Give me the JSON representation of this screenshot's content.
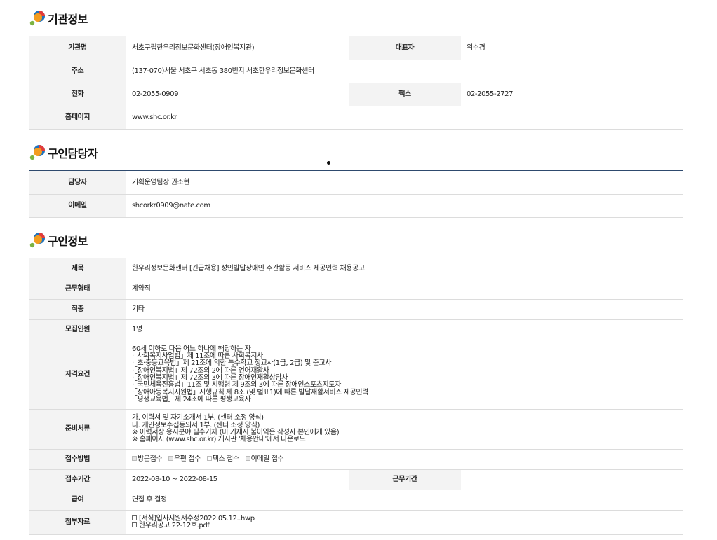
{
  "org": {
    "title": "기관정보",
    "rows": {
      "name_label": "기관명",
      "name_value": "서초구립한우리정보문화센터(장애인복지관)",
      "rep_label": "대표자",
      "rep_value": "위수경",
      "addr_label": "주소",
      "addr_value": "(137-070)서울 서초구 서초동 380번지 서초한우리정보문화센터",
      "tel_label": "전화",
      "tel_value": "02-2055-0909",
      "fax_label": "팩스",
      "fax_value": "02-2055-2727",
      "home_label": "홈페이지",
      "home_value": "www.shc.or.kr"
    }
  },
  "contact": {
    "title": "구인담당자",
    "rows": {
      "person_label": "담당자",
      "person_value": "기획운영팀장 권소현",
      "email_label": "이메일",
      "email_value": "shcorkr0909@nate.com"
    }
  },
  "job": {
    "title": "구인정보",
    "rows": {
      "subject_label": "제목",
      "subject_value": "한우리정보문화센터 [긴급채용] 성인발달장애인 주간활동 서비스 제공인력 채용공고",
      "type_label": "근무형태",
      "type_value": "계약직",
      "kind_label": "직종",
      "kind_value": "기타",
      "count_label": "모집인원",
      "count_value": "1명",
      "qual_label": "자격요건",
      "qual_lines": [
        "60세 이하로 다음 어느 하나에 해당하는 자",
        "·「사회복지사업법」제 11조에 따른 사회복지사",
        "·「초·중등교육법」제 21조에 의한 특수학교 정교사(1급, 2급) 및 준교사",
        "·「장애인복지법」제 72조의 2에 따른 언어재활사",
        "·「장애인복지법」제 72조의 3에 따른 장애인재활상담사",
        "·「국민체육진흥법」11조 및 시행령 제 9조의 3에 따른 장애인스포츠지도자",
        "·「장애아동복지지원법」시행규칙 제 8조 (및 별표1)에 따른 발달재활서비스 제공인력",
        "·「평생교육법」제 24조에 따른 평생교육사"
      ],
      "docs_label": "준비서류",
      "docs_lines": [
        "가. 이력서 및 자기소개서 1부. (센터 소정 양식)",
        "나. 개인정보수집동의서 1부. (센터 소정 양식)",
        "※ 이력서상 응시분야 필수기재 (미 기재시 불이익은 작성자 본인에게 있음)",
        "※ 홈페이지 (www.shc.or.kr) 게시판 '채용안내'에서 다운로드"
      ],
      "method_label": "접수방법",
      "method_options": [
        "방문접수",
        "우편 접수",
        "팩스 접수",
        "이메일 접수"
      ],
      "period_label": "접수기간",
      "period_value": "2022-08-10 ~ 2022-08-15",
      "workperiod_label": "근무기간",
      "workperiod_value": "",
      "pay_label": "급여",
      "pay_value": "면접 후 결정",
      "attach_label": "첨부자료",
      "attach_files": [
        "[서식]입사지원서수정2022.05.12..hwp",
        "한우리공고 22-12호.pdf"
      ]
    }
  },
  "colors": {
    "accent_top_line": "#2e4a6e",
    "header_bg": "#f3f3f3",
    "logo_orange": "#f39c1f",
    "logo_blue": "#1e73be",
    "logo_red": "#e23b3b",
    "logo_green": "#7cb342"
  }
}
